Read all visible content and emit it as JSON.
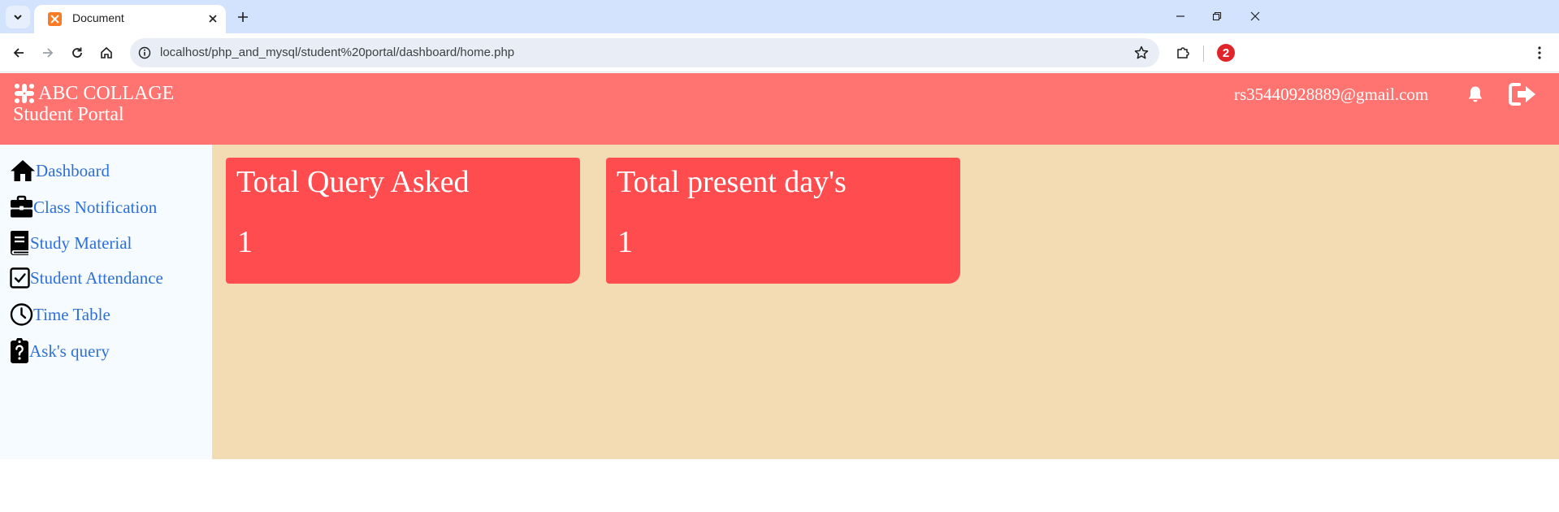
{
  "browser": {
    "tab_title": "Document",
    "url": "localhost/php_and_mysql/student%20portal/dashboard/home.php",
    "profile_badge": "2"
  },
  "header": {
    "brand_name": "ABC COLLAGE",
    "subtitle": "Student Portal",
    "email": "rs35440928889@gmail.com",
    "colors": {
      "header_bg": "#ff7370",
      "text": "#ffffff"
    }
  },
  "sidebar": {
    "items": [
      {
        "label": "Dashboard",
        "icon": "home-icon"
      },
      {
        "label": "Class Notification",
        "icon": "briefcase-icon"
      },
      {
        "label": "Study Material",
        "icon": "book-icon"
      },
      {
        "label": "Student Attendance",
        "icon": "checkbox-icon"
      },
      {
        "label": "Time Table",
        "icon": "clock-icon"
      },
      {
        "label": "Ask's query",
        "icon": "clipboard-question-icon"
      }
    ],
    "colors": {
      "link": "#2e6fd8",
      "bg": "#f5fbff"
    }
  },
  "cards": [
    {
      "title": "Total Query Asked",
      "value": "1"
    },
    {
      "title": "Total present day's",
      "value": "1"
    }
  ],
  "colors": {
    "main_bg": "#f3dcb3",
    "card_bg": "#ff4d4f"
  }
}
